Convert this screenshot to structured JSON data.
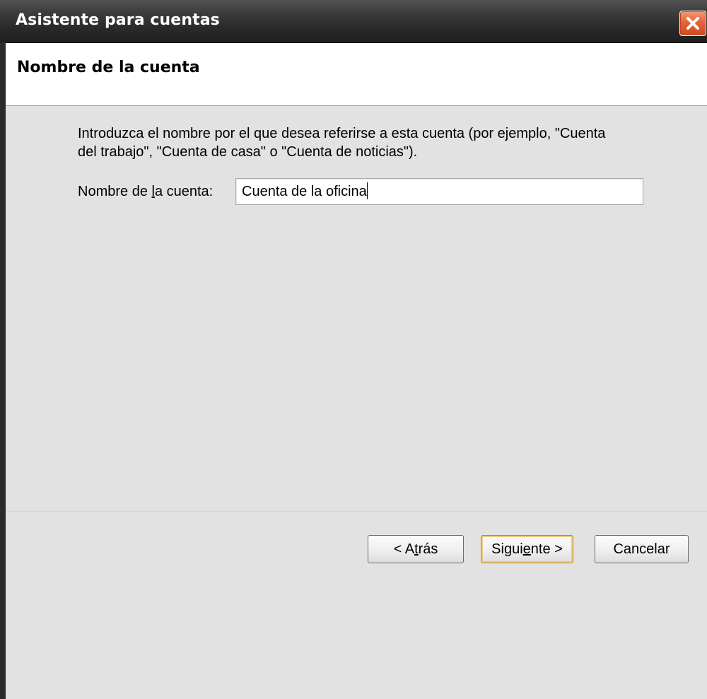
{
  "window": {
    "title": "Asistente para cuentas",
    "close_icon": "close-icon"
  },
  "header": {
    "title": "Nombre de la cuenta"
  },
  "content": {
    "description_line1": "Introduzca el nombre por el que desea referirse a esta cuenta (por ejemplo, \"Cuenta",
    "description_line2": "del trabajo\", \"Cuenta de casa\" o \"Cuenta de noticias\").",
    "field_label_before": "Nombre de ",
    "field_label_mnemonic": "l",
    "field_label_after": "a cuenta:",
    "account_name_value": "Cuenta de la oficina"
  },
  "buttons": {
    "back_prefix": "< A",
    "back_mnemonic": "t",
    "back_suffix": "rás",
    "next_prefix": "Sigui",
    "next_mnemonic": "e",
    "next_suffix": "nte >",
    "cancel_label": "Cancelar"
  },
  "colors": {
    "titlebar": "#2a2a2a",
    "close_button": "#e5643a",
    "dialog_background": "#e2e2e2",
    "default_button_border": "#b98b2f"
  }
}
